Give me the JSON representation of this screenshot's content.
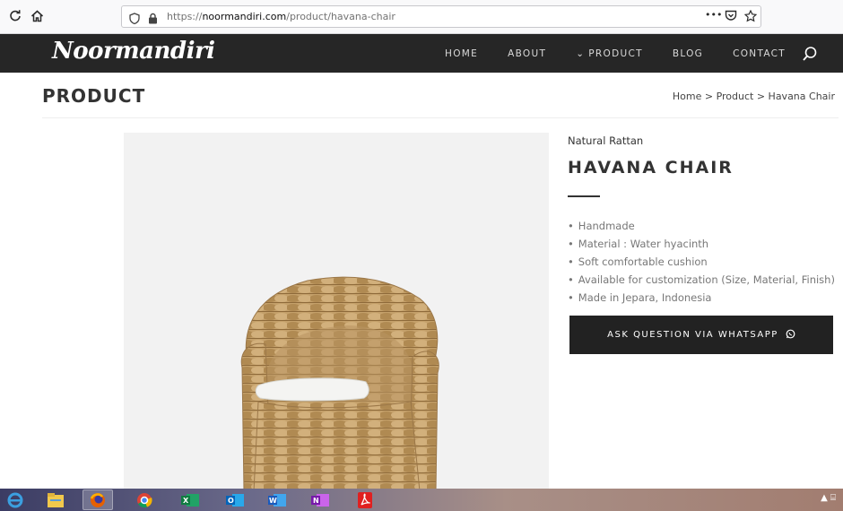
{
  "browser": {
    "url_prefix": "https://",
    "url_domain": "noormandiri.com",
    "url_path": "/product/havana-chair",
    "menu_dots": "•••"
  },
  "site": {
    "logo": "Noormandiri",
    "nav": [
      "HOME",
      "ABOUT",
      "PRODUCT",
      "BLOG",
      "CONTACT"
    ],
    "product_chevron": "⌄"
  },
  "page": {
    "title": "PRODUCT",
    "breadcrumb": "Home > Product > Havana Chair"
  },
  "product": {
    "category": "Natural Rattan",
    "name": "HAVANA CHAIR",
    "features": [
      "Handmade",
      "Material : Water hyacinth",
      "Soft comfortable cushion",
      "Available for customization (Size, Material, Finish)",
      "Made in Jepara, Indonesia"
    ],
    "button": "ASK QUESTION VIA WHATSAPP"
  },
  "colors": {
    "header_bg": "#262626",
    "button_bg": "#222222",
    "image_bg": "#f2f2f2"
  },
  "icons": {
    "reload": "reload-icon",
    "home": "home-icon",
    "shield": "shield-icon",
    "lock": "lock-icon",
    "pocket": "pocket-icon",
    "bookmark": "star-icon",
    "search": "search-icon",
    "whatsapp": "whatsapp-icon"
  },
  "taskbar": {
    "apps": [
      "Internet Explorer",
      "File Explorer",
      "Firefox",
      "Chrome",
      "Excel",
      "Outlook",
      "Word",
      "OneNote",
      "Acrobat"
    ],
    "tray": "▲ ⌸"
  }
}
